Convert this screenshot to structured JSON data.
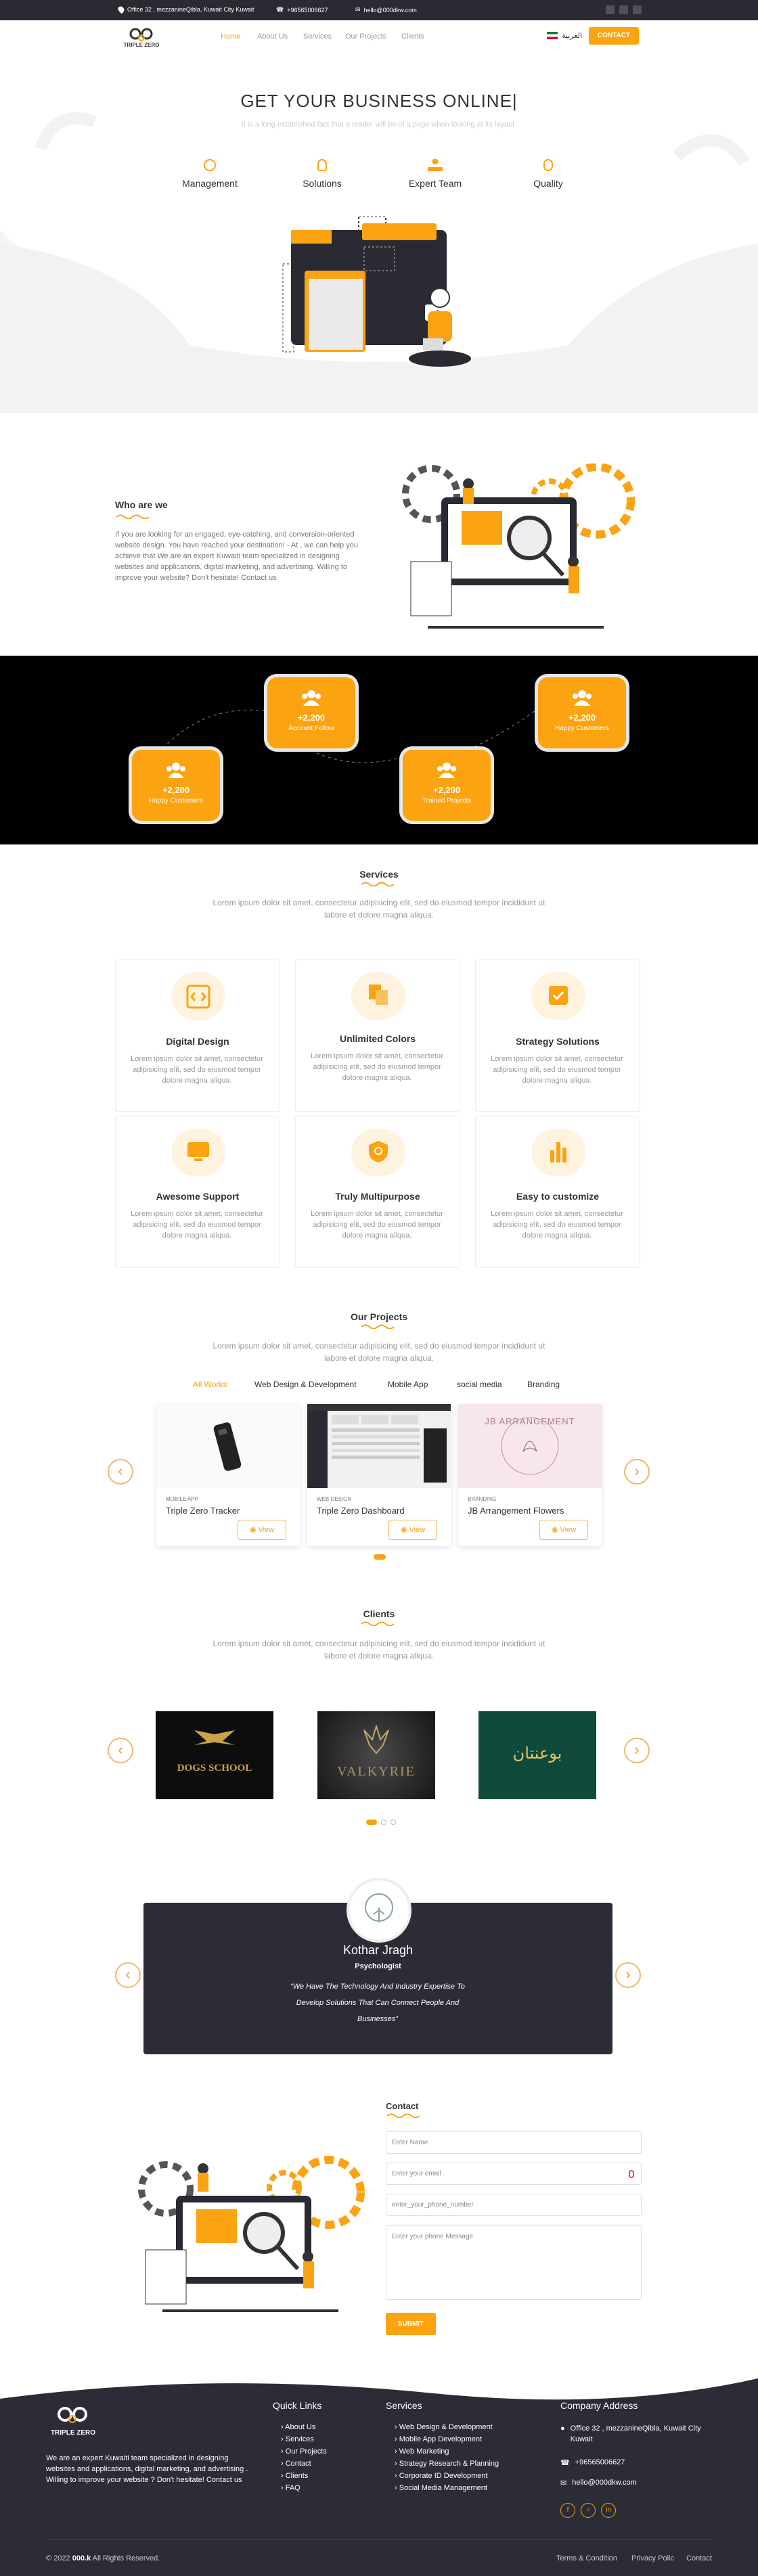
{
  "topbar": {
    "address": "Office 32 , mezzanineQibla, Kuwait City Kuwait",
    "phone": "+96565006627",
    "email": "hello@000dkw.com"
  },
  "nav": {
    "logo": "TRIPLE ZERO",
    "links": [
      "Home",
      "About Us",
      "Services",
      "Our Projects",
      "Clients"
    ],
    "lang": "العربية",
    "contact": "CONTACT"
  },
  "hero": {
    "title": "GET YOUR BUSINESS ONLINE|",
    "subtitle": "It is a long established fact that a reader will be of a page when looking at its layout.",
    "features": [
      "Management",
      "Solutions",
      "Expert Team",
      "Quality"
    ]
  },
  "about": {
    "title": "Who are we",
    "text": "If you are looking for an engaged, eye-catching, and conversion-oriented website design. You have reached your destination! - At , we can help you achieve that We are an expert Kuwaiti team specialized in designing websites and applications, digital marketing, and advertising. Willing to improve your website? Don't hesitate! Contact us"
  },
  "stats": [
    {
      "num": "+2,200",
      "label": "Happy Customers"
    },
    {
      "num": "+2,200",
      "label": "Account Follow"
    },
    {
      "num": "+2,200",
      "label": "Trained Projects"
    },
    {
      "num": "+2,200",
      "label": "Happy Customers"
    }
  ],
  "services": {
    "title": "Services",
    "subtitle": "Lorem ipsum dolor sit amet, consectetur adipisicing elit, sed do eiusmod tempor incididunt ut labore et dolore magna aliqua.",
    "items": [
      {
        "title": "Digital Design",
        "text": "Lorem ipsum dolor sit amet, consectetur adipisicing elit, sed do eiusmod tempor dolore magna aliqua."
      },
      {
        "title": "Unlimited Colors",
        "text": "Lorem ipsum dolor sit amet, consectetur adipisicing elit, sed do eiusmod tempor dolore magna aliqua."
      },
      {
        "title": "Strategy Solutions",
        "text": "Lorem ipsum dolor sit amet, consectetur adipisicing elit, sed do eiusmod tempor dolore magna aliqua."
      },
      {
        "title": "Awesome Support",
        "text": "Lorem ipsum dolor sit amet, consectetur adipisicing elit, sed do eiusmod tempor dolore magna aliqua."
      },
      {
        "title": "Truly Multipurpose",
        "text": "Lorem ipsum dolor sit amet, consectetur adipisicing elit, sed do eiusmod tempor dolore magna aliqua."
      },
      {
        "title": "Easy to customize",
        "text": "Lorem ipsum dolor sit amet, consectetur adipisicing elit, sed do eiusmod tempor dolore magna aliqua."
      }
    ]
  },
  "projects": {
    "title": "Our Projects",
    "subtitle": "Lorem ipsum dolor sit amet, consectetur adipisicing elit, sed do eiusmod tempor incididunt ut labore et dolore magna aliqua.",
    "filters": [
      "All Works",
      "Web Design & Development",
      "Mobile App",
      "social media",
      "Branding"
    ],
    "items": [
      {
        "cat": "MOBILE APP",
        "name": "Triple Zero Tracker",
        "view": "View"
      },
      {
        "cat": "WEB DESIGN",
        "name": "Triple Zero Dashboard",
        "view": "View"
      },
      {
        "cat": "BRANDING",
        "name": "JB Arrangement Flowers",
        "view": "View"
      }
    ],
    "flower_logo": "JB ARRANGEMENT"
  },
  "clients": {
    "title": "Clients",
    "subtitle": "Lorem ipsum dolor sit amet, consectetur adipisicing elit, sed do eiusmod tempor incididunt ut labore et dolore magna aliqua.",
    "logos": [
      "DOGS SCHOOL",
      "VALKYRIE",
      "بوعنتان"
    ]
  },
  "testimonial": {
    "name": "Kothar Jragh",
    "role": "Psychologist",
    "quote": "We Have The Technology And Industry Expertise To Develop Solutions That Can Connect People And Businesses"
  },
  "contact": {
    "title": "Contact",
    "name_ph": "Enter Name",
    "email_ph": "Enter your email",
    "phone_ph": "enter_your_phone_number",
    "msg_ph": "Enter your phone Message",
    "submit": "SUBMIT"
  },
  "footer": {
    "logo": "TRIPLE ZERO",
    "about": "We are an expert Kuwaiti team specialized in designing websites and applications, digital marketing, and advertising . Willing to improve your website ? Don't hesitate! Contact us",
    "quick_title": "Quick Links",
    "quick": [
      "About Us",
      "Services",
      "Our Projects",
      "Contact",
      "Clients",
      "FAQ"
    ],
    "services_title": "Services",
    "services": [
      "Web Design & Development",
      "Mobile App Development",
      "Web Marketing",
      "Strategy Research & Planning",
      "Corporate ID Development",
      "Social Media Management"
    ],
    "address_title": "Company Address",
    "address": "Office 32 , mezzanineQibla, Kuwait City Kuwait",
    "phone": "+96565006627",
    "email": "hello@000dkw.com",
    "copy_pre": "© 2022 ",
    "copy_brand": "000.k",
    "copy_post": " All Rights Reserved.",
    "bottom_links": [
      "Terms & Condition",
      "Privacy Polic",
      "Contact"
    ]
  },
  "colors": {
    "accent": "#fca311",
    "dark": "#2a2a33"
  }
}
